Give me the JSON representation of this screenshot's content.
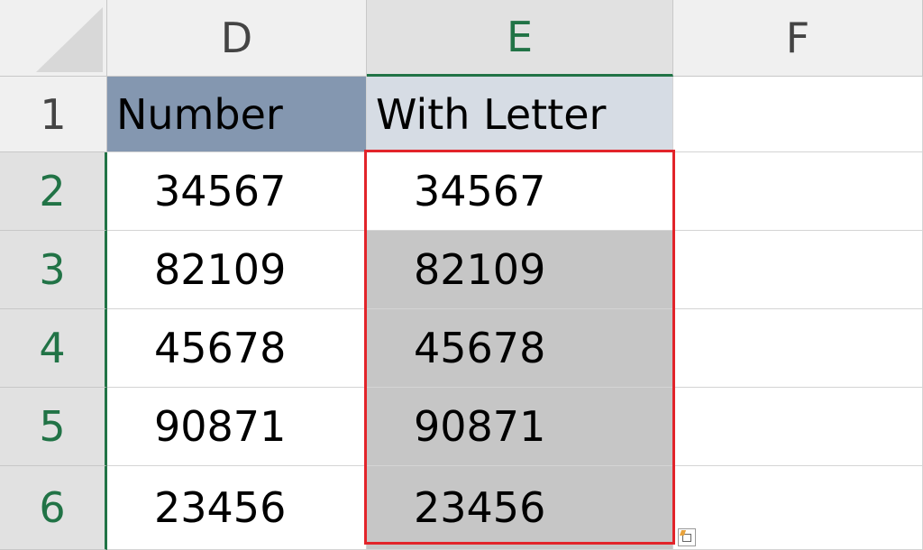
{
  "columns": [
    "D",
    "E",
    "F"
  ],
  "rows": [
    "1",
    "2",
    "3",
    "4",
    "5",
    "6"
  ],
  "header_row": {
    "d": "Number",
    "e": "With Letter"
  },
  "data_rows": [
    {
      "d": "34567",
      "e": "34567"
    },
    {
      "d": "82109",
      "e": "82109"
    },
    {
      "d": "45678",
      "e": "45678"
    },
    {
      "d": "90871",
      "e": "90871"
    },
    {
      "d": "23456",
      "e": "23456"
    }
  ],
  "colors": {
    "header_d_fill": "#8497b0",
    "header_e_fill": "#d6dce4",
    "selection_border": "#e2242a",
    "selected_fill": "#c6c6c6",
    "excel_green": "#217346"
  },
  "icons": {
    "quick_analysis": "quick-analysis-icon"
  }
}
